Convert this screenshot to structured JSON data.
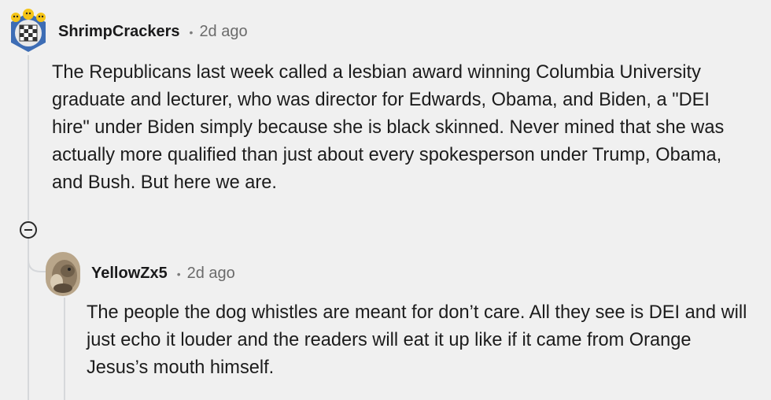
{
  "comments": [
    {
      "username": "ShrimpCrackers",
      "separator": "•",
      "age": "2d ago",
      "avatar_icon": "snoo-avatar-icon",
      "body": "The Republicans last week called a lesbian award winning Columbia University graduate and lecturer, who was director for Edwards, Obama, and Biden, a \"DEI hire\" under Biden simply because she is black skinned. Never mined that she was actually more qualified than just about every spokesperson under Trump, Obama, and Bush. But here we are."
    },
    {
      "username": "YellowZx5",
      "separator": "•",
      "age": "2d ago",
      "avatar_icon": "user-photo-avatar-icon",
      "body": "The people the dog whistles are meant for don’t care. All they see is DEI and will just echo it louder and the readers will eat it up like if it came from Orange Jesus’s mouth himself."
    }
  ],
  "controls": {
    "collapse_icon": "collapse-minus-icon"
  },
  "colors": {
    "background": "#f0f0f0",
    "thread_line": "#d6d8db",
    "username": "#1a1a1b",
    "meta": "#6b6b6b"
  }
}
